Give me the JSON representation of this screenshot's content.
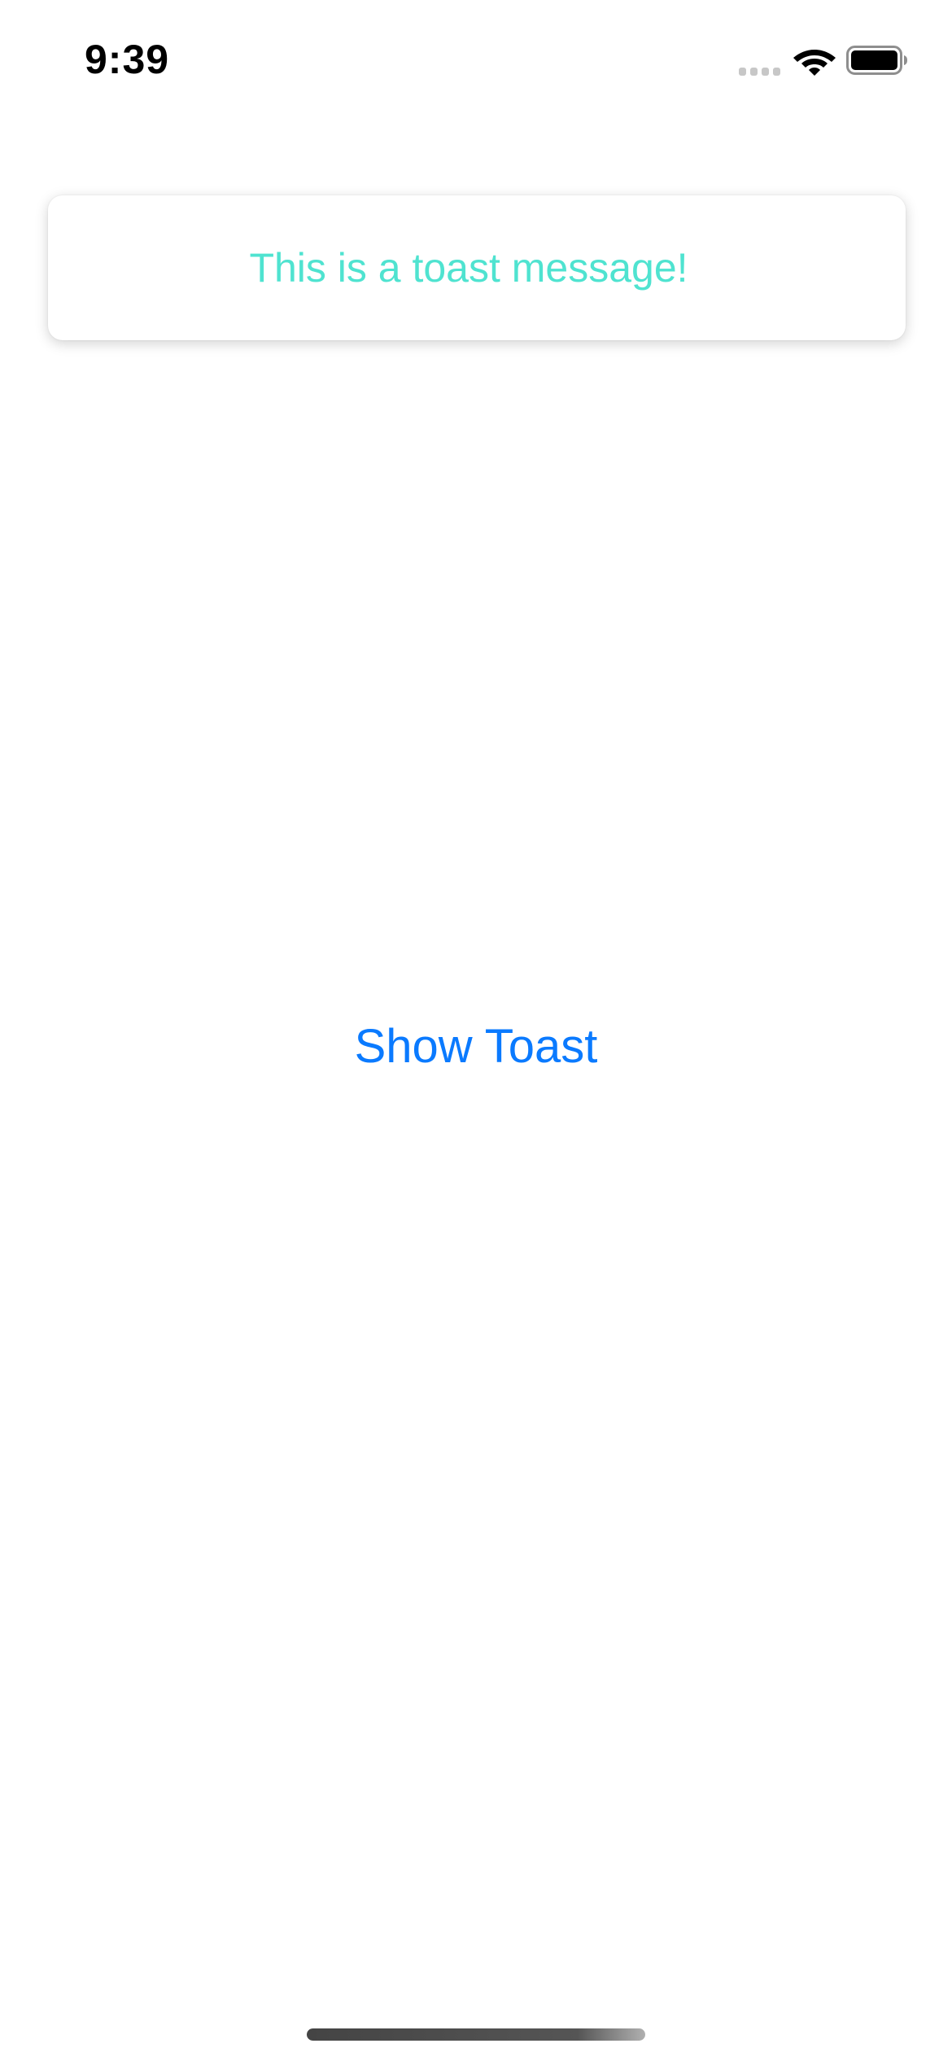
{
  "status_bar": {
    "time": "9:39",
    "icons": [
      "signal-icon",
      "wifi-icon",
      "battery-icon"
    ]
  },
  "toast": {
    "message": "This is a toast message!",
    "text_color": "#4fe3d0"
  },
  "main": {
    "show_toast_label": "Show Toast",
    "accent_color": "#0a7aff"
  }
}
